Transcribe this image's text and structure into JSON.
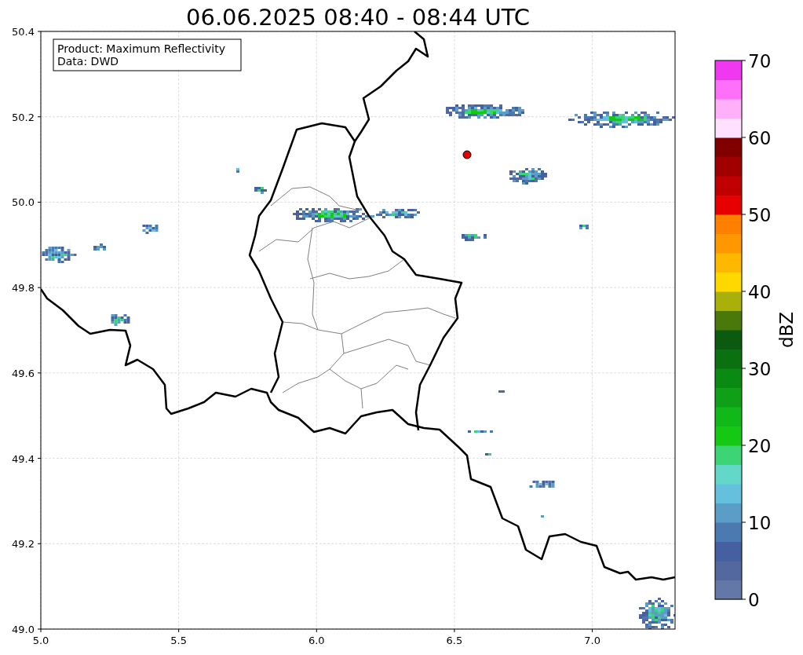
{
  "title": "06.06.2025 08:40 - 08:44 UTC",
  "info_box": {
    "lines": [
      "Product: Maximum Reflectivity",
      "Data: DWD"
    ]
  },
  "map": {
    "x_ticks": [
      "5.0",
      "5.5",
      "6.0",
      "6.5",
      "7.0"
    ],
    "y_ticks": [
      "50.4",
      "50.2",
      "50.0",
      "49.8",
      "49.6",
      "49.4",
      "49.2",
      "49.0"
    ]
  },
  "colorbar": {
    "label": "dBZ",
    "ticks": [
      "70",
      "60",
      "50",
      "40",
      "30",
      "20",
      "10",
      "0"
    ],
    "bins": [
      {
        "color": "#6478a8"
      },
      {
        "color": "#5468a0"
      },
      {
        "color": "#4460a0"
      },
      {
        "color": "#4a7ab0"
      },
      {
        "color": "#5a9ec8"
      },
      {
        "color": "#64c0dc"
      },
      {
        "color": "#64d8c8"
      },
      {
        "color": "#3cd474"
      },
      {
        "color": "#14c814"
      },
      {
        "color": "#10b818"
      },
      {
        "color": "#10a018"
      },
      {
        "color": "#0a8a10"
      },
      {
        "color": "#0a7010"
      },
      {
        "color": "#0a5a10"
      },
      {
        "color": "#4a780a"
      },
      {
        "color": "#aab00a"
      },
      {
        "color": "#ffd800"
      },
      {
        "color": "#ffb800"
      },
      {
        "color": "#ff9800"
      },
      {
        "color": "#ff8000"
      },
      {
        "color": "#e60000"
      },
      {
        "color": "#c00000"
      },
      {
        "color": "#a00000"
      },
      {
        "color": "#800000"
      },
      {
        "color": "#ffe0ff"
      },
      {
        "color": "#ffb0f8"
      },
      {
        "color": "#ff70f8"
      },
      {
        "color": "#f038f0"
      }
    ]
  }
}
